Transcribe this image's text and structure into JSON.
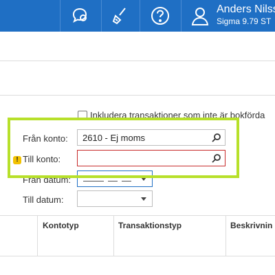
{
  "header": {
    "user_name": "Anders Nilss",
    "user_sub": "Sigma 9.79 ST",
    "icons": [
      "chat-icon",
      "broom-icon",
      "help-icon",
      "user-icon"
    ]
  },
  "form": {
    "include_checkbox_label": "Inkludera transaktioner som inte är bokförda",
    "from_account_label": "Från konto:",
    "from_account_value": "2610 - Ej moms",
    "to_account_label": "Till konto:",
    "to_account_value": "",
    "from_date_label": "Från datum:",
    "to_date_label": "Till datum:"
  },
  "table": {
    "columns": [
      "Kontotyp",
      "Transaktionstyp",
      "Beskrivnin"
    ]
  },
  "colors": {
    "header_bg": "#1f6fc4",
    "highlight": "#b7e02a",
    "error_border": "#c62828",
    "warning": "#f2c200"
  }
}
